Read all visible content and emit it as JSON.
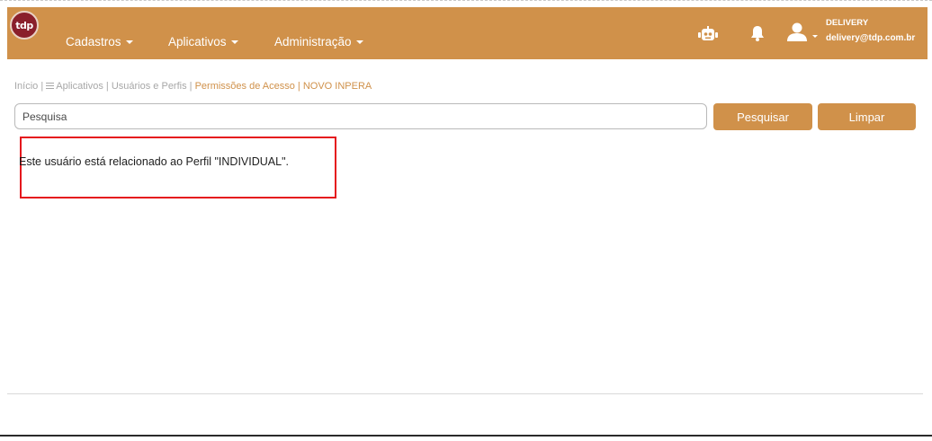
{
  "app": {
    "logo_text": "tdp"
  },
  "nav": {
    "items": [
      {
        "label": "Cadastros"
      },
      {
        "label": "Aplicativos"
      },
      {
        "label": "Administração"
      }
    ]
  },
  "user": {
    "name": "DELIVERY",
    "email": "delivery@tdp.com.br"
  },
  "icons": {
    "robot": "robot-icon",
    "bell": "bell-icon",
    "user": "user-icon"
  },
  "breadcrumb": {
    "home": "Início |",
    "apps": "Aplicativos |",
    "users": "Usuários e Perfis |",
    "current": "Permissões de Acesso | NOVO INPERA"
  },
  "search": {
    "placeholder": "Pesquisa",
    "value": ""
  },
  "buttons": {
    "search": "Pesquisar",
    "clear": "Limpar"
  },
  "message": "Este usuário está relacionado ao Perfil \"INDIVIDUAL\".",
  "colors": {
    "brand": "#d0914a",
    "logo_bg": "#8a1f2b",
    "highlight": "#e5161d"
  }
}
